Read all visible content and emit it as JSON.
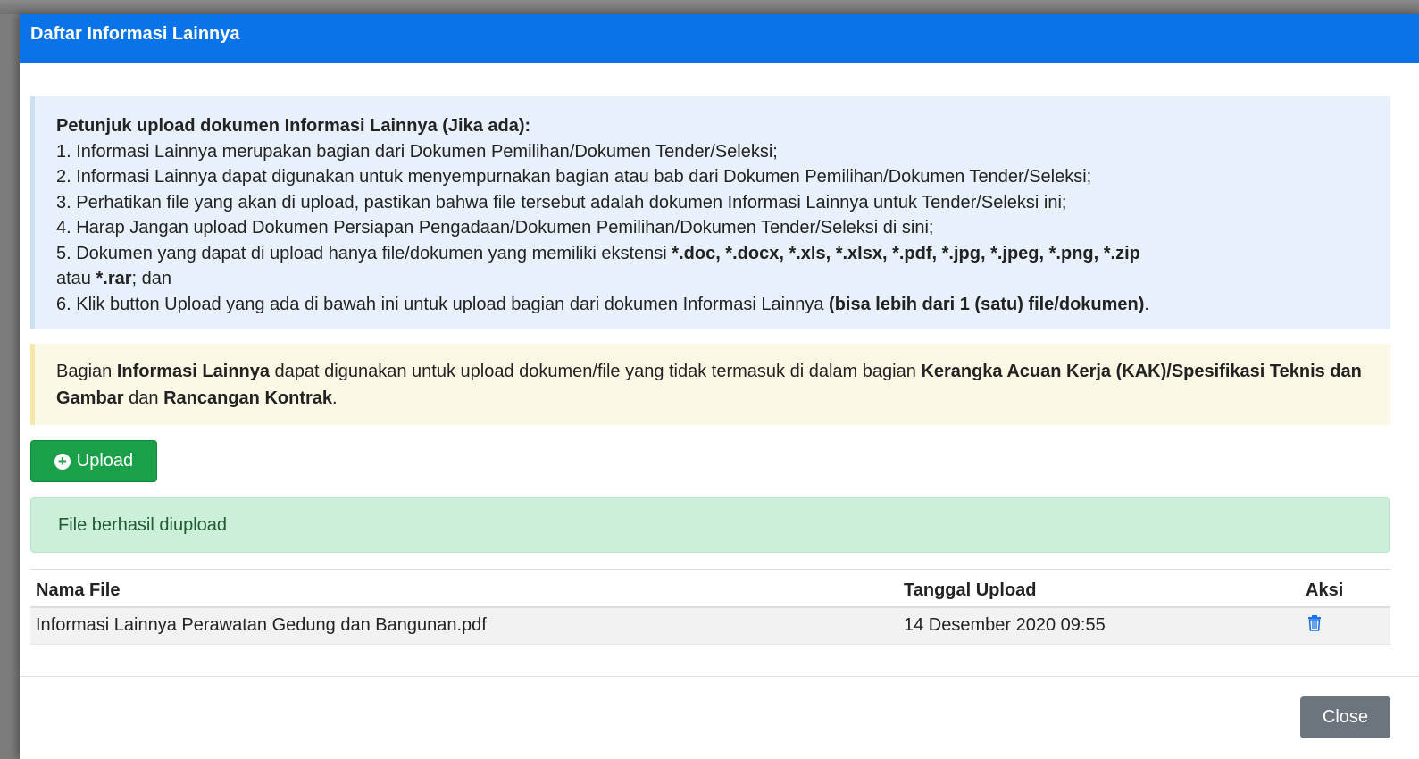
{
  "modal": {
    "title": "Daftar Informasi Lainnya"
  },
  "instructions": {
    "title": "Petunjuk upload dokumen Informasi Lainnya (Jika ada):",
    "item1": "1. Informasi Lainnya merupakan bagian dari Dokumen Pemilihan/Dokumen Tender/Seleksi;",
    "item2": "2. Informasi Lainnya dapat digunakan untuk menyempurnakan bagian atau bab dari Dokumen Pemilihan/Dokumen Tender/Seleksi;",
    "item3": "3. Perhatikan file yang akan di upload, pastikan bahwa file tersebut adalah dokumen Informasi Lainnya untuk Tender/Seleksi ini;",
    "item4": "4. Harap Jangan upload Dokumen Persiapan Pengadaan/Dokumen Pemilihan/Dokumen Tender/Seleksi di sini;",
    "item5_prefix": "5. Dokumen yang dapat di upload hanya file/dokumen yang memiliki ekstensi ",
    "item5_extensions": "*.doc, *.docx, *.xls, *.xlsx, *.pdf, *.jpg, *.jpeg, *.png, *.zip",
    "item5_or": " atau ",
    "item5_rar": "*.rar",
    "item5_suffix": "; dan",
    "item6_prefix": "6. Klik button Upload yang ada di bawah ini untuk upload bagian dari dokumen Informasi Lainnya ",
    "item6_bold": "(bisa lebih dari 1 (satu) file/dokumen)",
    "item6_suffix": "."
  },
  "note": {
    "p1": "Bagian ",
    "b1": "Informasi Lainnya",
    "p2": " dapat digunakan untuk upload dokumen/file yang tidak termasuk di dalam bagian ",
    "b2": "Kerangka Acuan Kerja (KAK)/Spesifikasi Teknis dan Gambar",
    "p3": " dan ",
    "b3": "Rancangan Kontrak",
    "p4": "."
  },
  "upload_button": {
    "icon": "plus-circle-icon",
    "label": "Upload"
  },
  "alert": {
    "message": "File berhasil diupload"
  },
  "table": {
    "headers": {
      "name": "Nama File",
      "date": "Tanggal Upload",
      "action": "Aksi"
    },
    "rows": [
      {
        "name": "Informasi Lainnya Perawatan Gedung dan Bangunan.pdf",
        "date": "14 Desember 2020 09:55",
        "action_icon": "trash-icon"
      }
    ]
  },
  "footer": {
    "close_label": "Close"
  },
  "colors": {
    "header_blue": "#0a73e8",
    "upload_green": "#1aa048",
    "success_bg": "#cbefd8",
    "info_bg": "#e8f1fb",
    "warning_bg": "#fcf8e6",
    "close_gray": "#6c757d",
    "trash_blue": "#1a73e8"
  }
}
